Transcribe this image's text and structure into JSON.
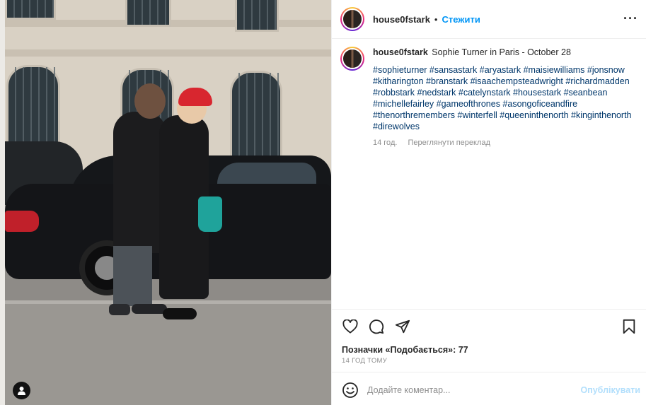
{
  "header": {
    "username": "house0fstark",
    "separator": "•",
    "follow_label": "Стежити",
    "more_label": "···"
  },
  "caption": {
    "username": "house0fstark",
    "text": "Sophie Turner in Paris - October 28",
    "hashtags": "#sophieturner #sansastark #aryastark #maisiewilliams #jonsnow #kitharington #branstark #isaachempsteadwright #richardmadden #robbstark #nedstark #catelynstark #housestark #seanbean #michellefairley #gameofthrones #asongoficeandfire #thenorthremembers #winterfell #queeninthenorth #kinginthenorth #direwolves",
    "age": "14 год.",
    "translate_label": "Переглянути переклад"
  },
  "actions": {
    "like_icon": "heart-icon",
    "comment_icon": "comment-icon",
    "share_icon": "share-icon",
    "save_icon": "bookmark-icon"
  },
  "likes_text": "Позначки «Подобається»: 77",
  "time_ago": "14 год тому",
  "comment": {
    "placeholder": "Додайте коментар...",
    "publish_label": "Опублікувати"
  },
  "colors": {
    "link_blue": "#0095f6",
    "hashtag": "#00376b",
    "publish_disabled": "#b2dffc"
  }
}
